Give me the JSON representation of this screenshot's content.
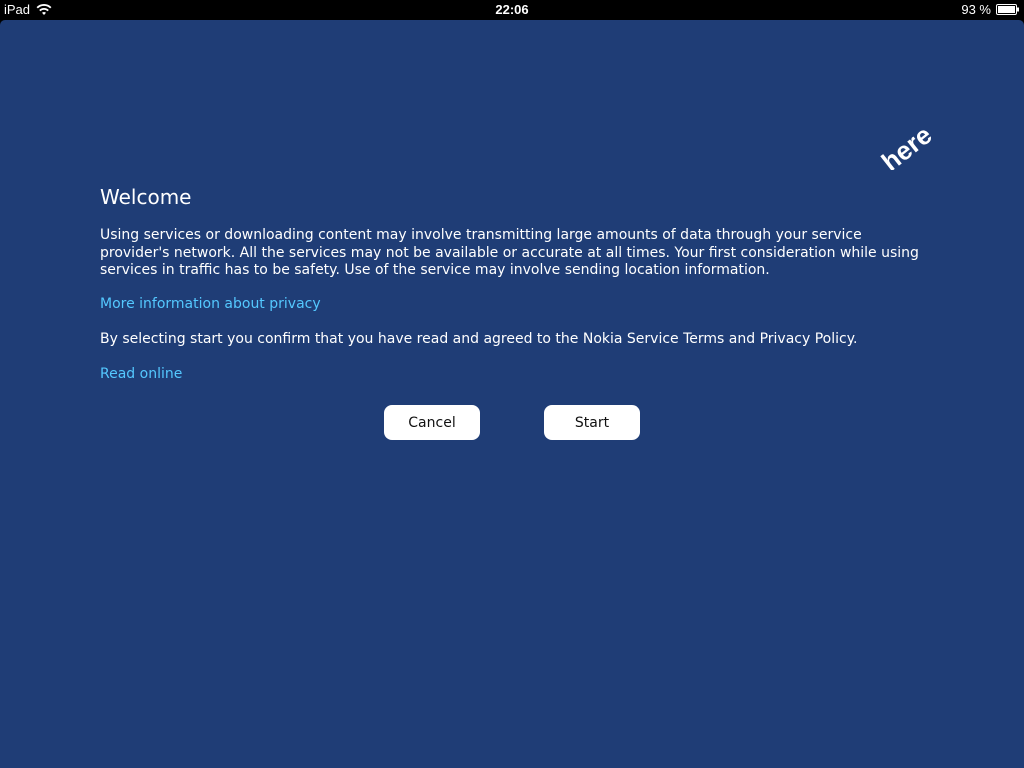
{
  "status_bar": {
    "device": "iPad",
    "time": "22:06",
    "battery": "93 %"
  },
  "logo": {
    "text": "here"
  },
  "welcome": {
    "title": "Welcome",
    "body": "Using services or downloading content may involve transmitting large amounts of data through your service provider's network. All the services may not be available or accurate at all times. Your first consideration while using services in traffic has to be safety. Use of the service may involve sending location information.",
    "privacy_link": "More information about privacy",
    "confirm_text": "By selecting start you confirm that you have read and agreed to the Nokia Service Terms and Privacy Policy.",
    "read_online_link": "Read online"
  },
  "buttons": {
    "cancel": "Cancel",
    "start": "Start"
  },
  "colors": {
    "background": "#1f3d76",
    "link": "#54c8ff"
  }
}
